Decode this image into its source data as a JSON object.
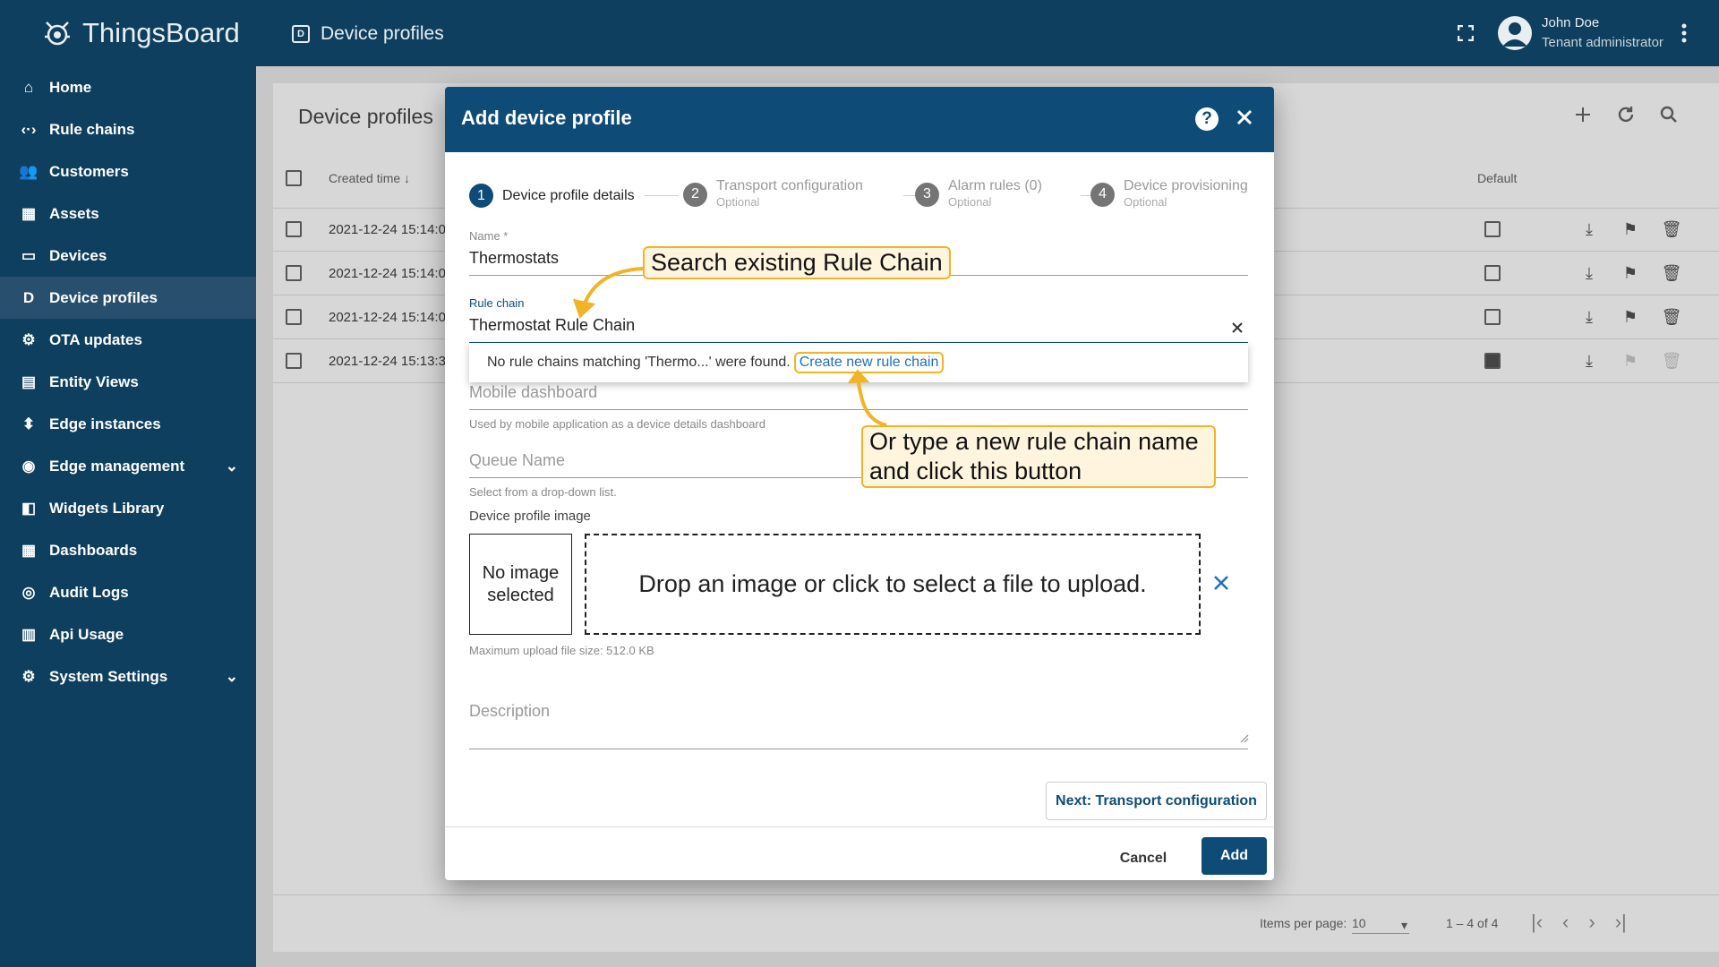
{
  "app": {
    "logo_text": "ThingsBoard",
    "page_title": "Device profiles",
    "user_name": "John Doe",
    "user_role": "Tenant administrator"
  },
  "sidebar": {
    "items": [
      {
        "label": "Home",
        "icon": "home-icon"
      },
      {
        "label": "Rule chains",
        "icon": "rule-chains-icon"
      },
      {
        "label": "Customers",
        "icon": "customers-icon"
      },
      {
        "label": "Assets",
        "icon": "assets-icon"
      },
      {
        "label": "Devices",
        "icon": "devices-icon"
      },
      {
        "label": "Device profiles",
        "icon": "device-profiles-icon",
        "active": true
      },
      {
        "label": "OTA updates",
        "icon": "ota-icon"
      },
      {
        "label": "Entity Views",
        "icon": "entity-views-icon"
      },
      {
        "label": "Edge instances",
        "icon": "edge-icon"
      },
      {
        "label": "Edge management",
        "icon": "edge-management-icon",
        "expandable": true
      },
      {
        "label": "Widgets Library",
        "icon": "widgets-icon"
      },
      {
        "label": "Dashboards",
        "icon": "dashboards-icon"
      },
      {
        "label": "Audit Logs",
        "icon": "audit-logs-icon"
      },
      {
        "label": "Api Usage",
        "icon": "api-usage-icon"
      },
      {
        "label": "System Settings",
        "icon": "settings-icon",
        "expandable": true
      }
    ]
  },
  "table": {
    "title": "Device profiles",
    "col_created": "Created time",
    "col_default": "Default",
    "rows": [
      {
        "created": "2021-12-24 15:14:0",
        "default": false
      },
      {
        "created": "2021-12-24 15:14:0",
        "default": false
      },
      {
        "created": "2021-12-24 15:14:0",
        "default": false
      },
      {
        "created": "2021-12-24 15:13:3",
        "default": true
      }
    ],
    "items_per_page_label": "Items per page:",
    "items_per_page": "10",
    "range": "1 – 4 of 4"
  },
  "dialog": {
    "title": "Add device profile",
    "steps": [
      {
        "num": "1",
        "label": "Device profile details",
        "sub": ""
      },
      {
        "num": "2",
        "label": "Transport configuration",
        "sub": "Optional"
      },
      {
        "num": "3",
        "label": "Alarm rules (0)",
        "sub": "Optional"
      },
      {
        "num": "4",
        "label": "Device provisioning",
        "sub": "Optional"
      }
    ],
    "name_label": "Name *",
    "name_value": "Thermostats",
    "rule_chain_label": "Rule chain",
    "rule_chain_value": "Thermostat Rule Chain",
    "dropdown_text": "No rule chains matching 'Thermo...' were found.",
    "create_link": "Create new rule chain",
    "mobile_dashboard_ph": "Mobile dashboard",
    "mobile_dashboard_hint": "Used by mobile application as a device details dashboard",
    "queue_ph": "Queue Name",
    "queue_hint": "Select from a drop-down list.",
    "image_label": "Device profile image",
    "no_image": "No image selected",
    "drop_text": "Drop an image or click to select a file to upload.",
    "max_size": "Maximum upload file size: 512.0 KB",
    "description_ph": "Description",
    "next_btn": "Next: Transport configuration",
    "cancel_btn": "Cancel",
    "add_btn": "Add"
  },
  "annotations": {
    "search_callout": "Search existing Rule Chain",
    "create_callout": "Or type a new rule chain name and click this button",
    "accent": "#f2b327"
  }
}
